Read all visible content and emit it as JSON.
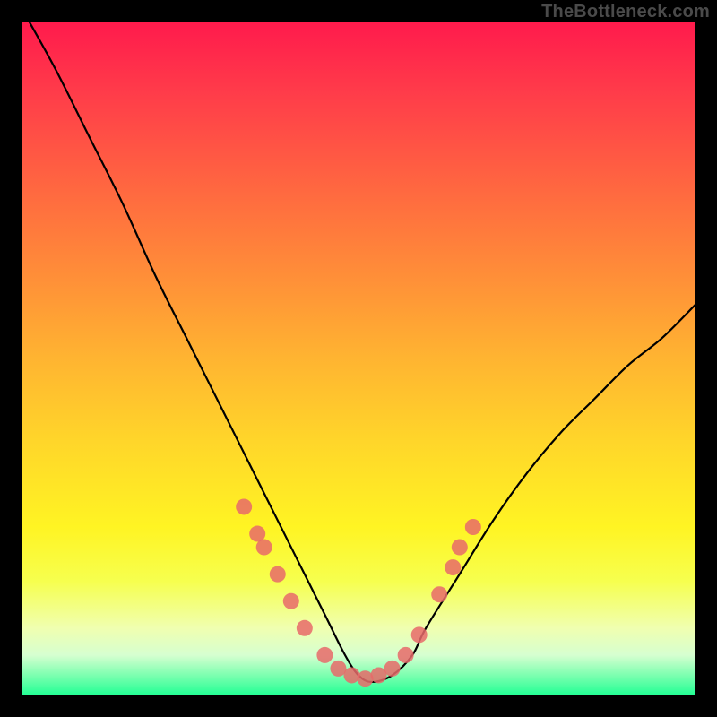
{
  "watermark": "TheBottleneck.com",
  "chart_data": {
    "type": "line",
    "title": "",
    "xlabel": "",
    "ylabel": "",
    "xlim": [
      0,
      100
    ],
    "ylim": [
      0,
      100
    ],
    "series": [
      {
        "name": "bottleneck-curve",
        "x": [
          0,
          5,
          10,
          15,
          20,
          25,
          30,
          35,
          40,
          45,
          48,
          50,
          52,
          55,
          58,
          60,
          65,
          70,
          75,
          80,
          85,
          90,
          95,
          100
        ],
        "values": [
          102,
          93,
          83,
          73,
          62,
          52,
          42,
          32,
          22,
          12,
          6,
          3,
          2,
          3,
          6,
          10,
          18,
          26,
          33,
          39,
          44,
          49,
          53,
          58
        ]
      }
    ],
    "markers": {
      "name": "highlighted-points",
      "color": "#e86a6a",
      "points": [
        {
          "x": 33,
          "y": 28
        },
        {
          "x": 35,
          "y": 24
        },
        {
          "x": 36,
          "y": 22
        },
        {
          "x": 38,
          "y": 18
        },
        {
          "x": 40,
          "y": 14
        },
        {
          "x": 42,
          "y": 10
        },
        {
          "x": 45,
          "y": 6
        },
        {
          "x": 47,
          "y": 4
        },
        {
          "x": 49,
          "y": 3
        },
        {
          "x": 51,
          "y": 2.5
        },
        {
          "x": 53,
          "y": 3
        },
        {
          "x": 55,
          "y": 4
        },
        {
          "x": 57,
          "y": 6
        },
        {
          "x": 59,
          "y": 9
        },
        {
          "x": 62,
          "y": 15
        },
        {
          "x": 64,
          "y": 19
        },
        {
          "x": 65,
          "y": 22
        },
        {
          "x": 67,
          "y": 25
        }
      ]
    },
    "gradient_stops": [
      {
        "pos": 0,
        "color": "#ff1a4c"
      },
      {
        "pos": 25,
        "color": "#ff6840"
      },
      {
        "pos": 50,
        "color": "#ffb431"
      },
      {
        "pos": 75,
        "color": "#fff423"
      },
      {
        "pos": 100,
        "color": "#21ff94"
      }
    ]
  }
}
